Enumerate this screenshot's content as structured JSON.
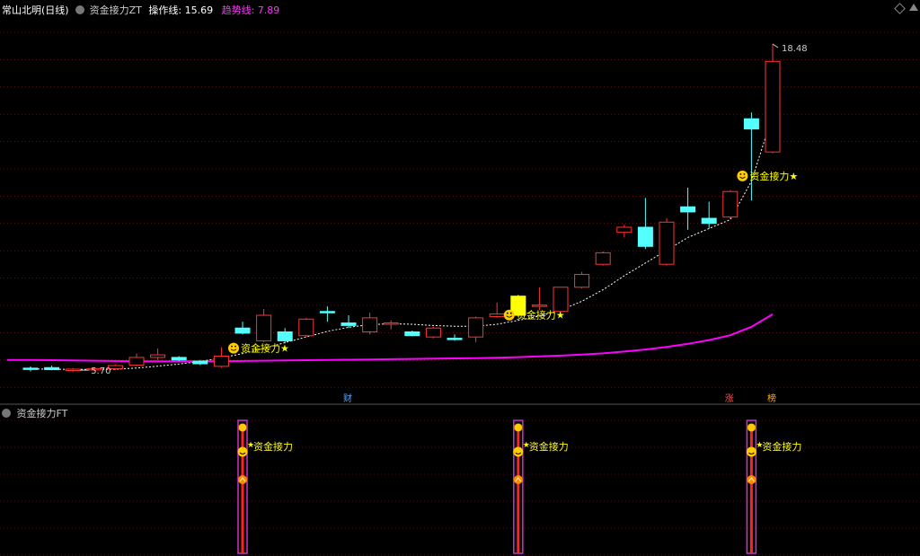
{
  "header": {
    "stock_name": "常山北明(日线)",
    "indicator_name": "资金接力ZT",
    "op_line_label": "操作线:",
    "op_line_value": "15.69",
    "trend_line_label": "趋势线:",
    "trend_line_value": "7.89"
  },
  "sub_panel": {
    "title": "资金接力FT",
    "signal_label": "资金接力"
  },
  "colors": {
    "up": "#ff3333",
    "down": "#54ffff",
    "yellow": "#ffff00",
    "ma": "#ff00ff",
    "dotted": "#ffffff",
    "grid": "#8a2020",
    "text": "#cccccc"
  },
  "markers": {
    "high_label": "18.48",
    "low_label": "5.70",
    "event_cai": "财",
    "event_zhang": "涨",
    "event_hot": "榜",
    "signal_text": "资金接力★"
  },
  "chart_data": {
    "type": "candlestick",
    "y_range": [
      5.0,
      19.5
    ],
    "candles": [
      {
        "o": 5.75,
        "h": 5.85,
        "l": 5.65,
        "c": 5.78,
        "t": "down"
      },
      {
        "o": 5.8,
        "h": 5.88,
        "l": 5.7,
        "c": 5.72,
        "t": "down"
      },
      {
        "o": 5.7,
        "h": 5.78,
        "l": 5.62,
        "c": 5.74,
        "t": "up"
      },
      {
        "o": 5.72,
        "h": 5.8,
        "l": 5.66,
        "c": 5.76,
        "t": "up"
      },
      {
        "o": 5.76,
        "h": 5.92,
        "l": 5.7,
        "c": 5.88,
        "t": "up"
      },
      {
        "o": 5.9,
        "h": 6.35,
        "l": 5.85,
        "c": 6.2,
        "t": "up"
      },
      {
        "o": 6.2,
        "h": 6.55,
        "l": 6.1,
        "c": 6.3,
        "t": "up"
      },
      {
        "o": 6.2,
        "h": 6.25,
        "l": 6.05,
        "c": 6.1,
        "t": "down"
      },
      {
        "o": 6.05,
        "h": 6.1,
        "l": 5.9,
        "c": 5.95,
        "t": "down"
      },
      {
        "o": 5.85,
        "h": 6.6,
        "l": 5.8,
        "c": 6.25,
        "t": "up"
      },
      {
        "o": 7.35,
        "h": 7.6,
        "l": 7.1,
        "c": 7.15,
        "t": "down"
      },
      {
        "o": 6.85,
        "h": 8.1,
        "l": 6.8,
        "c": 7.85,
        "t": "up"
      },
      {
        "o": 7.2,
        "h": 7.35,
        "l": 6.75,
        "c": 6.85,
        "t": "down"
      },
      {
        "o": 7.05,
        "h": 7.75,
        "l": 7.0,
        "c": 7.7,
        "t": "up"
      },
      {
        "o": 8.0,
        "h": 8.2,
        "l": 7.6,
        "c": 7.95,
        "t": "down"
      },
      {
        "o": 7.55,
        "h": 7.85,
        "l": 7.35,
        "c": 7.45,
        "t": "down"
      },
      {
        "o": 7.2,
        "h": 7.95,
        "l": 7.1,
        "c": 7.75,
        "t": "up"
      },
      {
        "o": 7.55,
        "h": 7.65,
        "l": 7.3,
        "c": 7.5,
        "t": "up"
      },
      {
        "o": 7.2,
        "h": 7.25,
        "l": 7.05,
        "c": 7.05,
        "t": "down"
      },
      {
        "o": 7.0,
        "h": 7.4,
        "l": 6.95,
        "c": 7.35,
        "t": "up"
      },
      {
        "o": 6.95,
        "h": 7.1,
        "l": 6.85,
        "c": 6.95,
        "t": "down"
      },
      {
        "o": 7.0,
        "h": 7.8,
        "l": 6.8,
        "c": 7.75,
        "t": "up"
      },
      {
        "o": 7.8,
        "h": 8.35,
        "l": 7.75,
        "c": 7.9,
        "t": "up"
      },
      {
        "o": 7.85,
        "h": 8.65,
        "l": 7.8,
        "c": 8.6,
        "t": "yellow"
      },
      {
        "o": 8.2,
        "h": 8.95,
        "l": 8.05,
        "c": 8.25,
        "t": "up"
      },
      {
        "o": 8.0,
        "h": 8.95,
        "l": 7.95,
        "c": 8.95,
        "t": "up"
      },
      {
        "o": 8.95,
        "h": 9.55,
        "l": 8.9,
        "c": 9.45,
        "t": "up"
      },
      {
        "o": 9.85,
        "h": 10.35,
        "l": 9.8,
        "c": 10.3,
        "t": "up"
      },
      {
        "o": 11.1,
        "h": 11.4,
        "l": 10.9,
        "c": 11.3,
        "t": "up"
      },
      {
        "o": 11.3,
        "h": 12.45,
        "l": 10.45,
        "c": 10.55,
        "t": "down"
      },
      {
        "o": 9.85,
        "h": 11.65,
        "l": 9.8,
        "c": 11.5,
        "t": "up"
      },
      {
        "o": 12.1,
        "h": 12.85,
        "l": 11.2,
        "c": 11.9,
        "t": "down"
      },
      {
        "o": 11.65,
        "h": 12.3,
        "l": 11.25,
        "c": 11.45,
        "t": "down"
      },
      {
        "o": 11.7,
        "h": 12.75,
        "l": 11.65,
        "c": 12.7,
        "t": "up"
      },
      {
        "o": 15.55,
        "h": 15.8,
        "l": 12.35,
        "c": 15.15,
        "t": "down"
      },
      {
        "o": 14.25,
        "h": 18.48,
        "l": 14.2,
        "c": 17.8,
        "t": "up"
      }
    ],
    "ma_trend": [
      6.1,
      6.09,
      6.08,
      6.07,
      6.06,
      6.05,
      6.05,
      6.05,
      6.05,
      6.05,
      6.06,
      6.07,
      6.08,
      6.09,
      6.1,
      6.11,
      6.12,
      6.13,
      6.14,
      6.15,
      6.16,
      6.17,
      6.19,
      6.21,
      6.24,
      6.27,
      6.31,
      6.36,
      6.43,
      6.51,
      6.61,
      6.73,
      6.88,
      7.07,
      7.4,
      7.89
    ],
    "op_line": [
      5.75,
      5.74,
      5.73,
      5.73,
      5.74,
      5.78,
      5.86,
      5.94,
      6.04,
      6.18,
      6.35,
      6.55,
      6.78,
      7.0,
      7.22,
      7.38,
      7.48,
      7.52,
      7.5,
      7.45,
      7.42,
      7.42,
      7.5,
      7.65,
      7.82,
      8.05,
      8.4,
      8.85,
      9.4,
      9.9,
      10.4,
      10.9,
      11.25,
      11.6,
      13.1,
      15.69
    ],
    "signals_main": [
      10,
      23,
      34
    ],
    "event_marks": [
      {
        "idx": 15,
        "key": "event_cai"
      },
      {
        "idx": 33,
        "key": "event_zhang"
      },
      {
        "idx": 35,
        "key": "event_hot"
      }
    ],
    "signals_sub": [
      10,
      23,
      34
    ]
  }
}
